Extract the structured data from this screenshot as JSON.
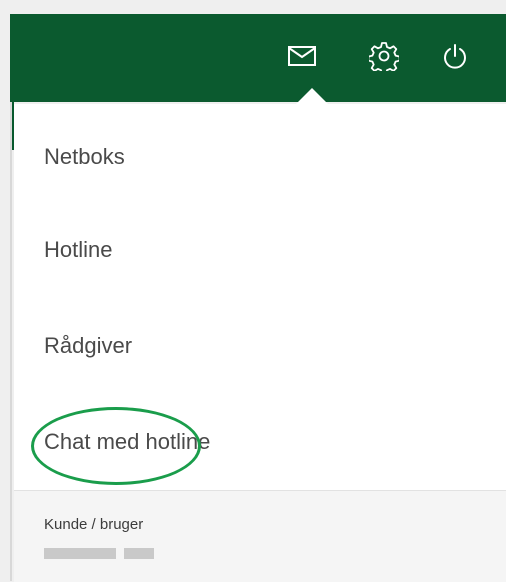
{
  "header": {
    "icons": [
      "mail-icon",
      "gear-icon",
      "power-icon"
    ],
    "color": "#0b5a2f"
  },
  "menu": {
    "items": [
      {
        "label": "Netboks"
      },
      {
        "label": "Hotline"
      },
      {
        "label": "Rådgiver"
      },
      {
        "label": "Chat med hotline"
      }
    ]
  },
  "footer": {
    "label": "Kunde / bruger"
  },
  "colors": {
    "accent_highlight": "#1a9d4b",
    "text": "#4a4a4a"
  }
}
